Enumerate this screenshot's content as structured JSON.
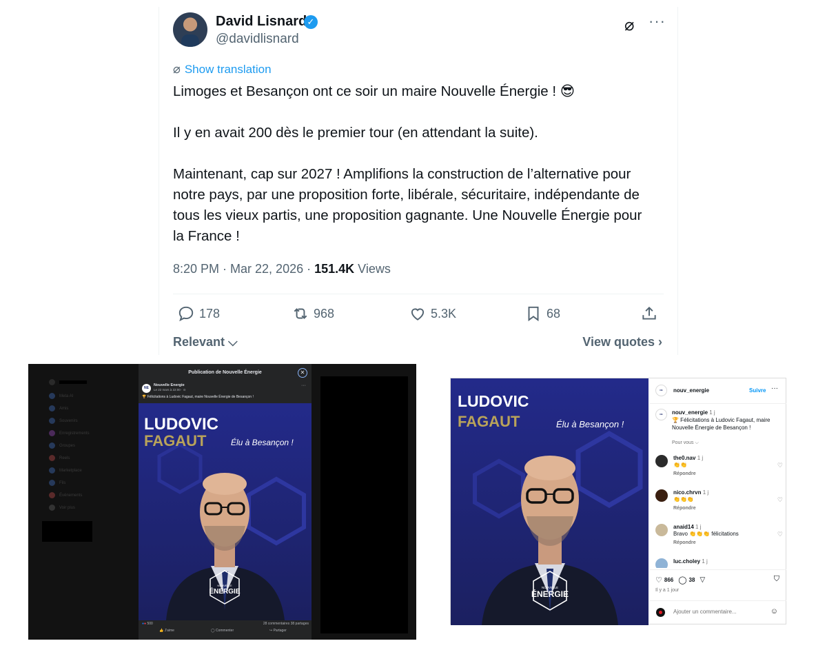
{
  "tweet": {
    "author_name": "David Lisnard",
    "handle": "@davidlisnard",
    "show_translation": "Show translation",
    "paragraphs": [
      "Limoges et Besançon ont ce soir un maire Nouvelle Énergie ! 😎",
      "Il y en avait 200 dès le premier tour (en attendant la suite).",
      "Maintenant, cap sur 2027 ! Amplifions la construction de l’alternative pour notre pays, par une proposition forte, libérale, sécuritaire, indépendante de tous les vieux partis, une proposition gagnante. Une Nouvelle Énergie pour la France !"
    ],
    "timestamp": "8:20 PM · Mar 22, 2026 · ",
    "views_count": "151.4K",
    "views_label": " Views",
    "replies": "178",
    "reposts": "968",
    "likes": "5.3K",
    "bookmarks": "68",
    "relevant": "Relevant",
    "view_quotes": "View quotes"
  },
  "poster": {
    "first_name": "LUDOVIC",
    "last_name": "FAGAUT",
    "tagline": "Élu à Besançon !",
    "brand_top": "NOUVELLE",
    "brand_bottom": "ÉNERGIE"
  },
  "facebook": {
    "modal_title": "Publication de Nouvelle Énergie",
    "page_name": "Nouvelle Energie",
    "post_date": "Le 22 mars à 22:00 · ⊙",
    "post_text": "🏆 Félicitations à Ludovic Fagaut, maire Nouvelle Énergie de Besançon !",
    "reactions": "500",
    "counts": "28 commentaires  38 partages",
    "like_label": "J'aime",
    "comment_label": "Commenter",
    "share_label": "Partager",
    "sidebar": [
      "Meta AI",
      "Amis",
      "Souvenirs",
      "Enregistrements",
      "Groupes",
      "Reels",
      "Marketplace",
      "Fils",
      "Évènements",
      "Voir plus"
    ]
  },
  "instagram": {
    "username": "nouv_energie",
    "follow": "Suivre",
    "caption_user": "nouv_energie",
    "caption_time": "1 j",
    "caption_text": "🏆 Félicitations à Ludovic Fagaut, maire Nouvelle Énergie de Besançon !",
    "for_you": "Pour vous ⌵",
    "comments": [
      {
        "user": "the0.nav",
        "time": "1 j",
        "text": "👏👏",
        "reply": "Répondre"
      },
      {
        "user": "nico.chrvn",
        "time": "1 j",
        "text": "👏👏👏",
        "reply": "Répondre"
      },
      {
        "user": "anaid14",
        "time": "1 j",
        "text": "Bravo 👏👏👏 félicitations",
        "reply": "Répondre"
      },
      {
        "user": "luc.choley",
        "time": "1 j",
        "text": "",
        "reply": ""
      }
    ],
    "likes": "866",
    "comment_count": "38",
    "ago": "Il y a 1 jour",
    "add_comment": "Ajouter un commentaire..."
  }
}
